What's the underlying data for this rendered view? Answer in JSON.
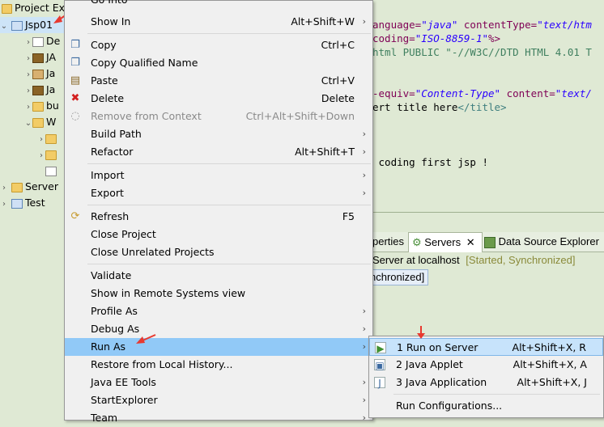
{
  "tree": {
    "header": "Project Ex",
    "project": "Jsp01",
    "items": [
      {
        "label": "De",
        "icon": "deployment-descriptor-icon"
      },
      {
        "label": "JA",
        "icon": "jax-ws-icon"
      },
      {
        "label": "Ja",
        "icon": "java-resources-icon"
      },
      {
        "label": "Ja",
        "icon": "javascript-resources-icon"
      },
      {
        "label": "bu",
        "icon": "build-folder-icon"
      },
      {
        "label": "W",
        "icon": "webcontent-folder-icon"
      },
      {
        "label": "",
        "icon": "folder-icon"
      },
      {
        "label": "",
        "icon": "folder-icon"
      },
      {
        "label": "",
        "icon": "jsp-file-icon"
      }
    ],
    "servers": "Server",
    "test": "Test"
  },
  "editor": {
    "lines": [
      {
        "parts": [
          {
            "t": "anguage=",
            "c": "kw"
          },
          {
            "t": "\"java\"",
            "c": "str"
          },
          {
            "t": " contentType=",
            "c": "kw"
          },
          {
            "t": "\"text/htm",
            "c": "str"
          }
        ]
      },
      {
        "parts": [
          {
            "t": "coding=",
            "c": "kw"
          },
          {
            "t": "\"ISO-8859-1\"",
            "c": "str"
          },
          {
            "t": "%>",
            "c": "kw"
          }
        ]
      },
      {
        "parts": [
          {
            "t": "html PUBLIC \"-//W3C//DTD HTML 4.01 T",
            "c": "cmt"
          }
        ]
      },
      {
        "parts": []
      },
      {
        "parts": []
      },
      {
        "parts": [
          {
            "t": "-equiv=",
            "c": "kw"
          },
          {
            "t": "\"Content-Type\"",
            "c": "str"
          },
          {
            "t": " content=",
            "c": "kw"
          },
          {
            "t": "\"text/",
            "c": "str"
          }
        ]
      },
      {
        "parts": [
          {
            "t": "ert title here",
            "c": ""
          },
          {
            "t": "</title>",
            "c": "tag"
          }
        ]
      },
      {
        "parts": []
      },
      {
        "parts": []
      },
      {
        "parts": []
      },
      {
        "parts": [
          {
            "t": " coding first jsp !",
            "c": ""
          }
        ]
      }
    ]
  },
  "servers_view": {
    "tabs": [
      "perties",
      "Servers",
      "Data Source Explorer"
    ],
    "server_name": "Server at localhost",
    "server_status": "[Started, Synchronized]",
    "publish_status": "nchronized]"
  },
  "menu": {
    "top_cut": "Go Into",
    "items": [
      {
        "label": "Show In",
        "acc": "Alt+Shift+W",
        "arrow": true,
        "icon": ""
      },
      {
        "sep": true
      },
      {
        "label": "Copy",
        "acc": "Ctrl+C",
        "icon": "copy-icon"
      },
      {
        "label": "Copy Qualified Name",
        "acc": "",
        "icon": "copy-qualified-icon"
      },
      {
        "label": "Paste",
        "acc": "Ctrl+V",
        "icon": "paste-icon"
      },
      {
        "label": "Delete",
        "acc": "Delete",
        "icon": "delete-icon"
      },
      {
        "label": "Remove from Context",
        "acc": "Ctrl+Alt+Shift+Down",
        "icon": "remove-context-icon",
        "disabled": true
      },
      {
        "label": "Build Path",
        "acc": "",
        "arrow": true,
        "icon": ""
      },
      {
        "label": "Refactor",
        "acc": "Alt+Shift+T",
        "arrow": true,
        "icon": ""
      },
      {
        "sep": true
      },
      {
        "label": "Import",
        "acc": "",
        "arrow": true,
        "icon": ""
      },
      {
        "label": "Export",
        "acc": "",
        "arrow": true,
        "icon": ""
      },
      {
        "sep": true
      },
      {
        "label": "Refresh",
        "acc": "F5",
        "icon": "refresh-icon"
      },
      {
        "label": "Close Project",
        "acc": "",
        "icon": ""
      },
      {
        "label": "Close Unrelated Projects",
        "acc": "",
        "icon": ""
      },
      {
        "sep": true
      },
      {
        "label": "Validate",
        "acc": "",
        "icon": ""
      },
      {
        "label": "Show in Remote Systems view",
        "acc": "",
        "icon": ""
      },
      {
        "label": "Profile As",
        "acc": "",
        "arrow": true,
        "icon": ""
      },
      {
        "label": "Debug As",
        "acc": "",
        "arrow": true,
        "icon": ""
      },
      {
        "label": "Run As",
        "acc": "",
        "arrow": true,
        "icon": "",
        "hot": true
      },
      {
        "label": "Restore from Local History...",
        "acc": "",
        "icon": ""
      },
      {
        "label": "Java EE Tools",
        "acc": "",
        "arrow": true,
        "icon": ""
      },
      {
        "label": "StartExplorer",
        "acc": "",
        "arrow": true,
        "icon": ""
      },
      {
        "label": "Team",
        "acc": "",
        "arrow": true,
        "icon": ""
      }
    ]
  },
  "submenu": {
    "items": [
      {
        "label": "1 Run on Server",
        "acc": "Alt+Shift+X, R",
        "icon": "run-on-server-icon",
        "hot": true
      },
      {
        "label": "2 Java Applet",
        "acc": "Alt+Shift+X, A",
        "icon": "java-applet-icon"
      },
      {
        "label": "3 Java Application",
        "acc": "Alt+Shift+X, J",
        "icon": "java-application-icon"
      },
      {
        "sep": true
      },
      {
        "label": "Run Configurations...",
        "acc": "",
        "icon": ""
      }
    ]
  },
  "colors": {
    "highlight": "#91c9f7",
    "menu_bg": "#f0f0f0",
    "annotation_arrow": "#e8392f"
  }
}
